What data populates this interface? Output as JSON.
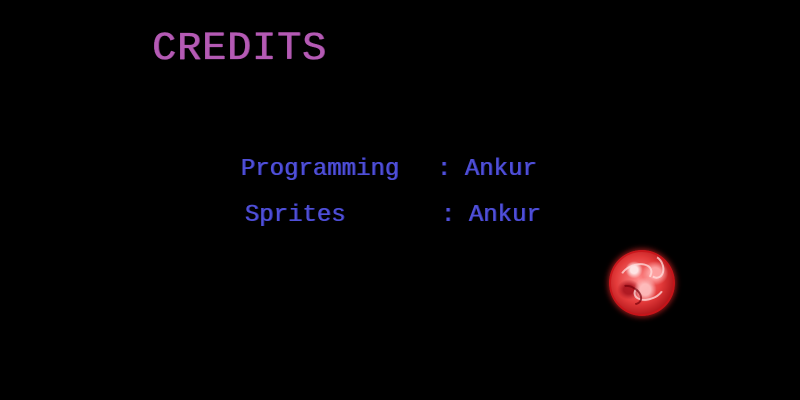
{
  "screen": {
    "title": "CREDITS",
    "credits": [
      {
        "role": "Programming",
        "separator": ":",
        "name": "Ankur"
      },
      {
        "role": "Sprites",
        "separator": ":",
        "name": "Ankur"
      }
    ],
    "decoration_icon": "red-planet-icon"
  },
  "colors": {
    "background": "#000000",
    "title": "#b45ab4",
    "credit_text": "#5050d8",
    "planet": "#e33a3a"
  }
}
